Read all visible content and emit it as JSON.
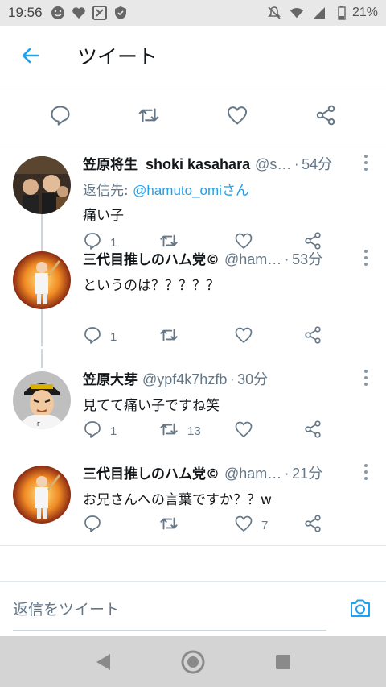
{
  "status_bar": {
    "time": "19:56",
    "battery": "21%",
    "left_icons": [
      "smiley-icon",
      "heart-icon",
      "app-icon",
      "shield-icon"
    ],
    "right_icons": [
      "notifications-off-icon",
      "wifi-icon",
      "signal-icon",
      "battery-icon"
    ]
  },
  "header": {
    "title": "ツイート",
    "back_icon": "back-arrow-icon"
  },
  "main_actions": [
    "reply-icon",
    "retweet-icon",
    "like-icon",
    "share-icon"
  ],
  "replies": [
    {
      "name": "笠原将生",
      "name2": "shoki kasahara",
      "handle": "@s…",
      "sep": "·",
      "time": "54分",
      "reply_to_label": "返信先: ",
      "reply_to_handle": "@hamuto_omiさん",
      "text": "痛い子",
      "reply_count": "1",
      "retweet_count": "",
      "like_count": ""
    },
    {
      "name": "三代目推しのハム党©",
      "handle": "@ham…",
      "sep": "·",
      "time": "53分",
      "text": "というのは？？？？？",
      "reply_count": "1",
      "retweet_count": "",
      "like_count": ""
    },
    {
      "name": "笠原大芽",
      "handle": "@ypf4k7hzfb",
      "sep": "·",
      "time": "30分",
      "text": "見てて痛い子ですね笑",
      "reply_count": "1",
      "retweet_count": "13",
      "like_count": ""
    },
    {
      "name": "三代目推しのハム党©",
      "handle": "@ham…",
      "sep": "·",
      "time": "21分",
      "text": "お兄さんへの言葉ですか？？w",
      "reply_count": "",
      "retweet_count": "",
      "like_count": "7"
    }
  ],
  "composer": {
    "placeholder": "返信をツイート",
    "camera_icon": "camera-icon"
  },
  "nav_bar": [
    "back-triangle-icon",
    "home-circle-icon",
    "recents-square-icon"
  ],
  "colors": {
    "accent": "#1da1f2",
    "icon_gray": "#657786",
    "text": "#14171a"
  }
}
